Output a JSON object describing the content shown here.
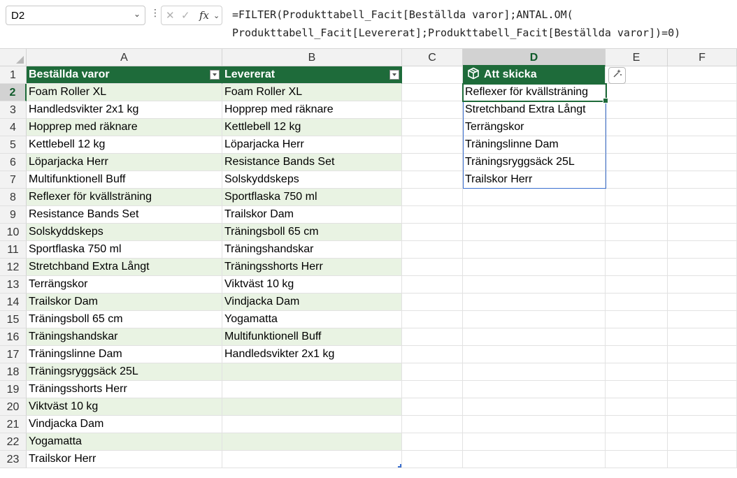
{
  "namebox": {
    "value": "D2"
  },
  "formula": "=FILTER(Produkttabell_Facit[Beställda varor];ANTAL.OM(\nProdukttabell_Facit[Levererat];Produkttabell_Facit[Beställda varor])=0)",
  "columns": [
    "A",
    "B",
    "C",
    "D",
    "E",
    "F"
  ],
  "selected_column": "D",
  "rows": [
    "1",
    "2",
    "3",
    "4",
    "5",
    "6",
    "7",
    "8",
    "9",
    "10",
    "11",
    "12",
    "13",
    "14",
    "15",
    "16",
    "17",
    "18",
    "19",
    "20",
    "21",
    "22",
    "23"
  ],
  "selected_row": "2",
  "table": {
    "headers": [
      "Beställda varor",
      "Levererat"
    ],
    "ordered": [
      "Foam Roller XL",
      "Handledsvikter 2x1 kg",
      "Hopprep med räknare",
      "Kettlebell 12 kg",
      "Löparjacka Herr",
      "Multifunktionell Buff",
      "Reflexer för kvällsträning",
      "Resistance Bands Set",
      "Solskyddskeps",
      "Sportflaska 750 ml",
      "Stretchband Extra Långt",
      "Terrängskor",
      "Trailskor Dam",
      "Träningsboll 65 cm",
      "Träningshandskar",
      "Träningslinne Dam",
      "Träningsryggsäck 25L",
      "Träningsshorts Herr",
      "Viktväst 10 kg",
      "Vindjacka Dam",
      "Yogamatta",
      "Trailskor Herr"
    ],
    "delivered": [
      "Foam Roller XL",
      "Hopprep med räknare",
      "Kettlebell 12 kg",
      "Löparjacka Herr",
      "Resistance Bands Set",
      "Solskyddskeps",
      "Sportflaska 750 ml",
      "Trailskor Dam",
      "Träningsboll 65 cm",
      "Träningshandskar",
      "Träningsshorts Herr",
      "Viktväst 10 kg",
      "Vindjacka Dam",
      "Yogamatta",
      "Multifunktionell Buff",
      "Handledsvikter 2x1 kg"
    ]
  },
  "result": {
    "header": "Att skicka",
    "values": [
      "Reflexer för kvällsträning",
      "Stretchband Extra Långt",
      "Terrängskor",
      "Träningslinne Dam",
      "Träningsryggsäck 25L",
      "Trailskor Herr"
    ]
  },
  "colors": {
    "table_header": "#1e6b3a",
    "band": "#e9f3e3",
    "spill_border": "#3b6fd0"
  },
  "icons": {
    "quick_analysis": "quick-analysis-icon",
    "cube": "cube-icon"
  }
}
